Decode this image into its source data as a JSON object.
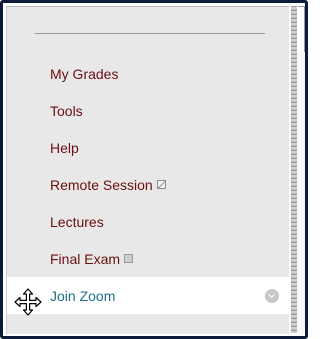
{
  "sidebar": {
    "items": [
      {
        "label": "My Grades",
        "icon": null,
        "active": false
      },
      {
        "label": "Tools",
        "icon": null,
        "active": false
      },
      {
        "label": "Help",
        "icon": null,
        "active": false
      },
      {
        "label": "Remote Session",
        "icon": "external-link-icon",
        "active": false
      },
      {
        "label": "Lectures",
        "icon": null,
        "active": false
      },
      {
        "label": "Final Exam",
        "icon": "document-icon",
        "active": false
      },
      {
        "label": "Join Zoom",
        "icon": "chevron-down-icon",
        "active": true
      }
    ]
  },
  "colors": {
    "item_text": "#6b0f0f",
    "active_text": "#1f6f8b",
    "sidebar_bg": "#e8e8e8",
    "frame_border": "#0d1a3a"
  }
}
